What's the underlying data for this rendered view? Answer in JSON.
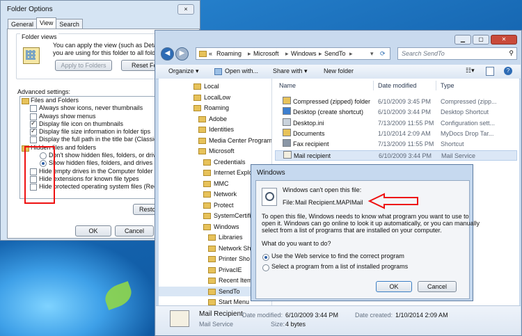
{
  "folder_options": {
    "title": "Folder Options",
    "close": "×",
    "tabs": [
      "General",
      "View",
      "Search"
    ],
    "folder_views_label": "Folder views",
    "folder_views_text_1": "You can apply the view (such as Details or",
    "folder_views_text_2": "you are using for this folder to all folders of t",
    "apply_button": "Apply to Folders",
    "reset_button": "Reset Fol",
    "advanced_label": "Advanced settings:",
    "settings": [
      {
        "label": "Files and Folders",
        "kind": "folder"
      },
      {
        "label": "Always show icons, never thumbnails",
        "kind": "check",
        "checked": false
      },
      {
        "label": "Always show menus",
        "kind": "check",
        "checked": false
      },
      {
        "label": "Display file icon on thumbnails",
        "kind": "check",
        "checked": true
      },
      {
        "label": "Display file size information in folder tips",
        "kind": "check",
        "checked": true
      },
      {
        "label": "Display the full path in the title bar (Classic theme",
        "kind": "check",
        "checked": false
      },
      {
        "label": "Hidden files and folders",
        "kind": "folder"
      },
      {
        "label": "Don't show hidden files, folders, or drives",
        "kind": "radio",
        "checked": false
      },
      {
        "label": "Show hidden files, folders, and drives",
        "kind": "radio",
        "checked": true
      },
      {
        "label": "Hide empty drives in the Computer folder",
        "kind": "check",
        "checked": false
      },
      {
        "label": "Hide extensions for known file types",
        "kind": "check",
        "checked": false
      },
      {
        "label": "Hide protected operating system files (Recommen",
        "kind": "check",
        "checked": false
      }
    ],
    "restore_button": "Restore",
    "ok_button": "OK",
    "cancel_button": "Cancel"
  },
  "explorer": {
    "breadcrumb": [
      "«",
      "Roaming",
      "Microsoft",
      "Windows",
      "SendTo"
    ],
    "search_placeholder": "Search SendTo",
    "commands": [
      "Organize ▾",
      "Open with...",
      "Share with ▾",
      "New folder"
    ],
    "nav_items": [
      {
        "label": "Local",
        "level": 0
      },
      {
        "label": "LocalLow",
        "level": 0
      },
      {
        "label": "Roaming",
        "level": 0
      },
      {
        "label": "Adobe",
        "level": 1
      },
      {
        "label": "Identities",
        "level": 1
      },
      {
        "label": "Media Center Program",
        "level": 1
      },
      {
        "label": "Microsoft",
        "level": 1
      },
      {
        "label": "Credentials",
        "level": 2
      },
      {
        "label": "Internet Explo",
        "level": 2
      },
      {
        "label": "MMC",
        "level": 2
      },
      {
        "label": "Network",
        "level": 2
      },
      {
        "label": "Protect",
        "level": 2
      },
      {
        "label": "SystemCertific",
        "level": 2
      },
      {
        "label": "Windows",
        "level": 2
      },
      {
        "label": "Libraries",
        "level": 3
      },
      {
        "label": "Network Sho",
        "level": 3
      },
      {
        "label": "Printer Sho",
        "level": 3
      },
      {
        "label": "PrivacIE",
        "level": 3
      },
      {
        "label": "Recent Item",
        "level": 3
      },
      {
        "label": "SendTo",
        "level": 3,
        "selected": true
      },
      {
        "label": "Start Menu",
        "level": 3
      }
    ],
    "columns": [
      "Name",
      "Date modified",
      "Type"
    ],
    "files": [
      {
        "name": "Compressed (zipped) folder",
        "date": "6/10/2009 3:45 PM",
        "type": "Compressed (zipp...",
        "icon": "zip-folder-icon"
      },
      {
        "name": "Desktop (create shortcut)",
        "date": "6/10/2009 3:44 PM",
        "type": "Desktop Shortcut",
        "icon": "desktop-icon"
      },
      {
        "name": "Desktop.ini",
        "date": "7/13/2009 11:55 PM",
        "type": "Configuration sett...",
        "icon": "settings-file-icon"
      },
      {
        "name": "Documents",
        "date": "1/10/2014 2:09 AM",
        "type": "MyDocs Drop Tar...",
        "icon": "documents-icon"
      },
      {
        "name": "Fax recipient",
        "date": "7/13/2009 11:55 PM",
        "type": "Shortcut",
        "icon": "fax-icon"
      },
      {
        "name": "Mail recipient",
        "date": "6/10/2009 3:44 PM",
        "type": "Mail Service",
        "icon": "mail-icon",
        "selected": true
      }
    ],
    "details": {
      "name": "Mail Recipient",
      "kind": "Mail Service",
      "date_modified_label": "Date modified:",
      "date_modified": "6/10/2009 3:44 PM",
      "size_label": "Size:",
      "size": "4 bytes",
      "date_created_label": "Date created:",
      "date_created": "1/10/2014 2:09 AM"
    }
  },
  "dialog": {
    "title": "Windows",
    "heading": "Windows can't open this file:",
    "file_label": "File:",
    "file_name": "Mail Recipient.MAPIMail",
    "info_1": "To open this file, Windows needs to know what program you want to use to",
    "info_2": "open it. Windows can go online to look it up automatically, or you can manually",
    "info_3": "select from a list of programs that are installed on your computer.",
    "question": "What do you want to do?",
    "option_web": "Use the Web service to find the correct program",
    "option_list": "Select a program from a list of installed programs",
    "ok_button": "OK",
    "cancel_button": "Cancel"
  },
  "colors": {
    "annotation_red": "#e11111",
    "selection_blue": "#dbe7f6"
  }
}
